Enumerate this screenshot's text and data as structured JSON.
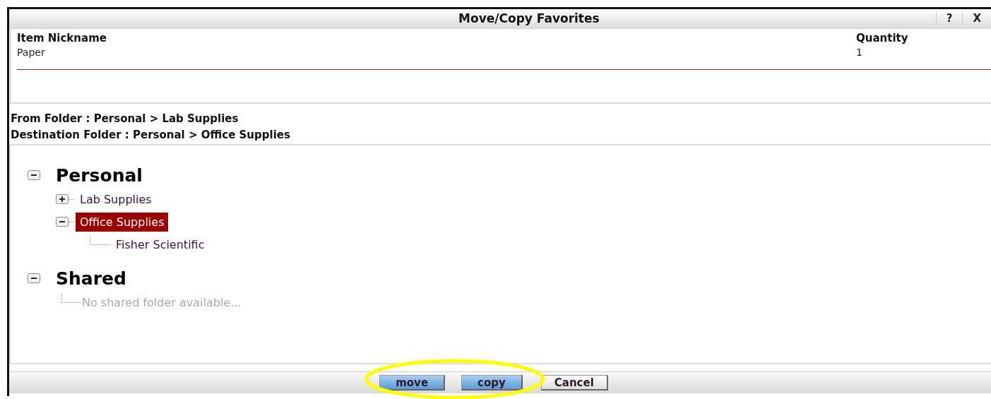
{
  "window": {
    "title": "Move/Copy Favorites",
    "controls": [
      "?",
      "X"
    ]
  },
  "items_table": {
    "columns": [
      "Item Nickname",
      "Quantity"
    ],
    "rows": [
      [
        "Paper",
        "1"
      ]
    ]
  },
  "from_folder": {
    "label": "From Folder :",
    "path": "Personal > Lab Supplies"
  },
  "destination_folder": {
    "label": "Destination Folder :",
    "path": "Personal > Office Supplies"
  },
  "tree": [
    {
      "label": "Personal",
      "kind": "root",
      "expanded": true,
      "children": [
        {
          "label": "Lab Supplies",
          "kind": "folder",
          "expanded": false,
          "selected": false
        },
        {
          "label": "Office Supplies",
          "kind": "folder",
          "expanded": true,
          "selected": true,
          "children": [
            {
              "label": "Fisher Scientific",
              "kind": "leaf",
              "selected": false
            }
          ]
        }
      ]
    },
    {
      "label": "Shared",
      "kind": "root",
      "expanded": true,
      "children": [
        {
          "label": "No shared folder available...",
          "kind": "empty"
        }
      ]
    }
  ],
  "buttons": [
    {
      "label": "move",
      "kind": "primary"
    },
    {
      "label": "copy",
      "kind": "primary"
    },
    {
      "label": "Cancel",
      "kind": "secondary"
    }
  ]
}
